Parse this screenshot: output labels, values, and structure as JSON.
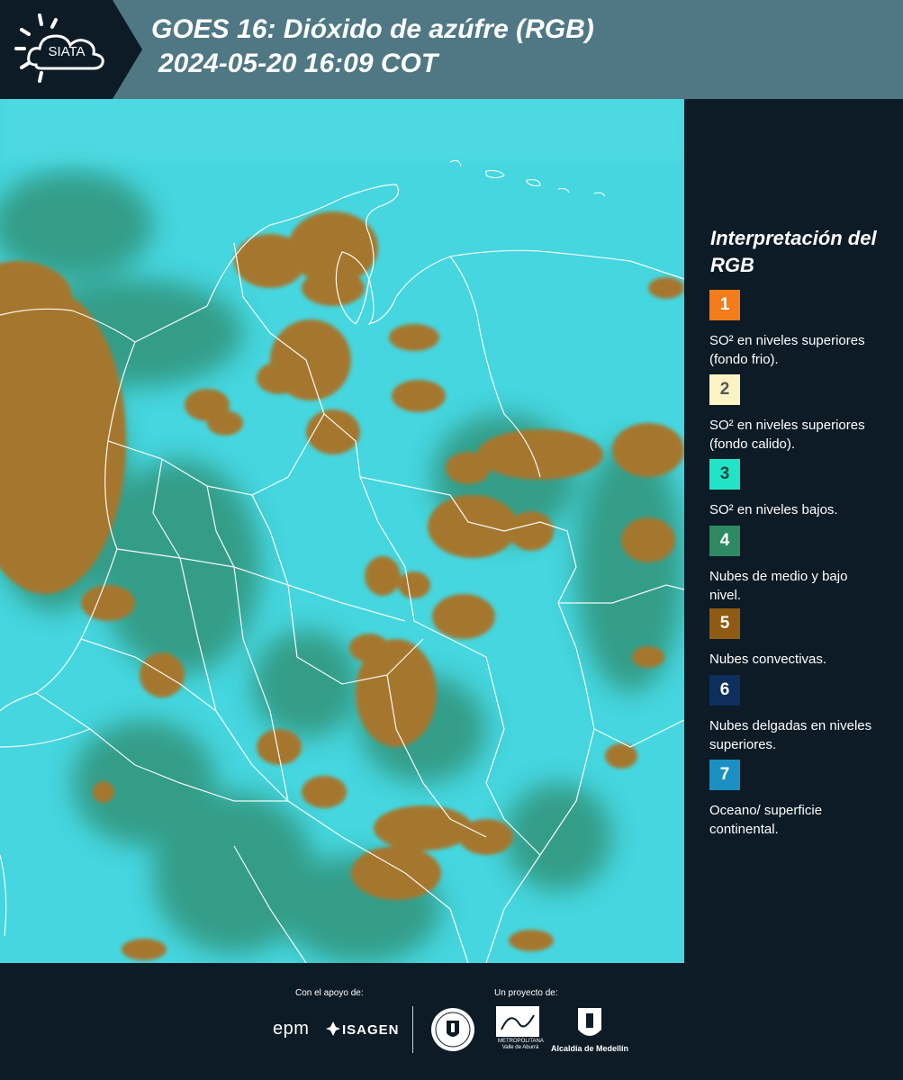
{
  "header": {
    "logo_text": "SIATA",
    "title_line1": "GOES 16: Dióxido de azúfre (RGB)",
    "title_line2": "2024-05-20 16:09 COT"
  },
  "legend": {
    "title": "Interpretación del RGB",
    "items": [
      {
        "number": "1",
        "label": "SO² en niveles superiores (fondo frio).",
        "color": "#f47c1b"
      },
      {
        "number": "2",
        "label": "SO² en niveles superiores (fondo calido).",
        "color": "#fcf3c4"
      },
      {
        "number": "3",
        "label": "SO² en niveles bajos.",
        "color": "#23e3c6"
      },
      {
        "number": "4",
        "label": "Nubes de medio y bajo nivel.",
        "color": "#2e8a63"
      },
      {
        "number": "5",
        "label": "Nubes convectivas.",
        "color": "#8f5b14"
      },
      {
        "number": "6",
        "label": "Nubes delgadas en niveles superiores.",
        "color": "#0e2f5e"
      },
      {
        "number": "7",
        "label": "Oceano/ superficie continental.",
        "color": "#1b8fc1"
      }
    ]
  },
  "map": {
    "colors": {
      "surface": "#3fd9e0",
      "convective": "#a5772d",
      "midlevel": "#2f8a6c",
      "boundary": "#ffffff"
    }
  },
  "footer": {
    "support_label": "Con el apoyo de:",
    "project_label": "Un proyecto de:",
    "sponsor1": "epm",
    "sponsor2": "ISAGEN",
    "area_name": "Área",
    "area_subtitle": "METROPOLITANA Valle de Aburrá",
    "alcaldia": "Alcaldía de Medellín"
  }
}
